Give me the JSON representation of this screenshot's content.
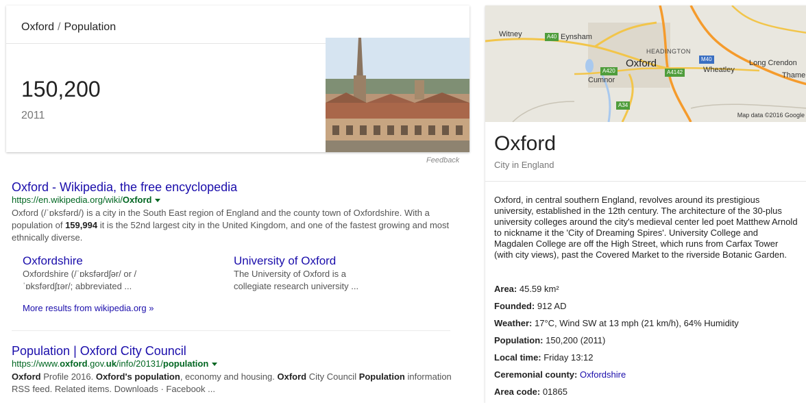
{
  "answer": {
    "breadcrumb_place": "Oxford",
    "breadcrumb_sep": "/",
    "breadcrumb_topic": "Population",
    "value": "150,200",
    "year": "2011",
    "feedback": "Feedback"
  },
  "results": [
    {
      "title": "Oxford - Wikipedia, the free encyclopedia",
      "url_parts": [
        "https://en.wikipedia.org/wiki/",
        "Oxford"
      ],
      "snippet_parts": [
        "Oxford (/ˈɒksfərd/) is a city in the South East region of England and the county town of Oxfordshire. With a population of ",
        "159,994",
        " it is the 52nd largest city in the United Kingdom, and one of the fastest growing and most ethnically diverse."
      ]
    },
    {
      "title": "Population | Oxford City Council",
      "url_parts": [
        "https://www.",
        "oxford",
        ".gov.",
        "uk",
        "/info/20131/",
        "population"
      ],
      "snippet_parts": [
        "Oxford",
        " Profile 2016. ",
        "Oxford's population",
        ", economy and housing. ",
        "Oxford",
        " City Council ",
        "Population",
        " information RSS feed. Related items. Downloads · Facebook ..."
      ]
    }
  ],
  "sitelinks": [
    {
      "title": "Oxfordshire",
      "snippet_lines": [
        "Oxfordshire (/ˈɒksfərdʃər/ or /",
        "ˈɒksfərdʃɪər/; abbreviated ..."
      ]
    },
    {
      "title": "University of Oxford",
      "snippet_lines": [
        "The University of Oxford is a",
        "collegiate research university ..."
      ]
    }
  ],
  "more_results": "More results from wikipedia.org »",
  "knowledge_panel": {
    "map": {
      "labels": {
        "witney": "Witney",
        "eynsham": "Eynsham",
        "headington": "HEADINGTON",
        "oxford": "Oxford",
        "wheatley": "Wheatley",
        "long_crendon": "Long Crendon",
        "thame": "Thame",
        "cumnor": "Cumnor"
      },
      "roads": {
        "a40": "A40",
        "m40": "M40",
        "a420": "A420",
        "a4142": "A4142",
        "a34": "A34"
      },
      "attribution": "Map data ©2016 Google"
    },
    "title": "Oxford",
    "subtitle": "City in England",
    "description": "Oxford, in central southern England, revolves around its prestigious university, established in the 12th century. The architecture of the 30-plus university colleges around the city's medieval center led poet Matthew Arnold to nickname it the 'City of Dreaming Spires'. University College and Magdalen College are off the High Street, which runs from Carfax Tower (with city views), past the Covered Market to the riverside Botanic Garden.",
    "facts": [
      {
        "label": "Area:",
        "value": " 45.59 km²"
      },
      {
        "label": "Founded:",
        "value": " 912 AD"
      },
      {
        "label": "Weather:",
        "value": " 17°C, Wind SW at 13 mph (21 km/h), 64% Humidity"
      },
      {
        "label": "Population:",
        "value": " 150,200 (2011)"
      },
      {
        "label": "Local time:",
        "value": " Friday 13:12"
      },
      {
        "label": "Ceremonial county:",
        "value": " ",
        "link": "Oxfordshire"
      },
      {
        "label": "Area code:",
        "value": " 01865"
      }
    ]
  },
  "colors": {
    "link": "#1a0dab",
    "url": "#006621",
    "snippet": "#545454"
  }
}
